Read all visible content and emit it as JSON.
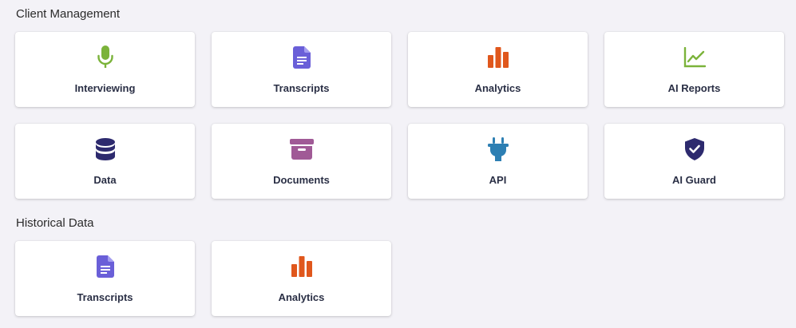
{
  "sections": [
    {
      "title": "Client Management",
      "tiles": [
        {
          "label": "Interviewing",
          "icon": "microphone-icon",
          "color": "#7bb33a"
        },
        {
          "label": "Transcripts",
          "icon": "document-icon",
          "color": "#6a5fd8"
        },
        {
          "label": "Analytics",
          "icon": "bar-chart-icon",
          "color": "#e0571c"
        },
        {
          "label": "AI Reports",
          "icon": "line-chart-icon",
          "color": "#7bb33a"
        },
        {
          "label": "Data",
          "icon": "database-icon",
          "color": "#2d2a6e"
        },
        {
          "label": "Documents",
          "icon": "archive-box-icon",
          "color": "#a05a96"
        },
        {
          "label": "API",
          "icon": "plug-icon",
          "color": "#2d7fb3"
        },
        {
          "label": "AI Guard",
          "icon": "shield-check-icon",
          "color": "#2d2a6e"
        }
      ]
    },
    {
      "title": "Historical Data",
      "tiles": [
        {
          "label": "Transcripts",
          "icon": "document-icon",
          "color": "#6a5fd8"
        },
        {
          "label": "Analytics",
          "icon": "bar-chart-icon",
          "color": "#e0571c"
        }
      ]
    }
  ]
}
